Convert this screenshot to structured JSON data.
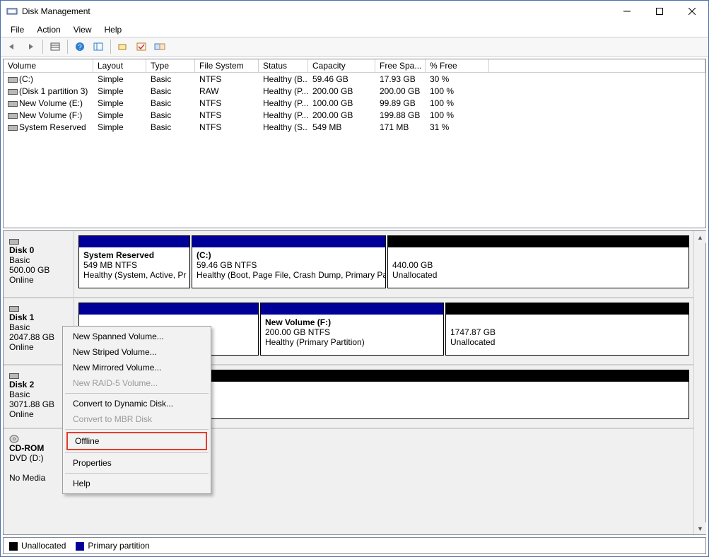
{
  "window": {
    "title": "Disk Management"
  },
  "menu": {
    "file": "File",
    "action": "Action",
    "view": "View",
    "help": "Help"
  },
  "columns": {
    "volume": "Volume",
    "layout": "Layout",
    "type": "Type",
    "fs": "File System",
    "status": "Status",
    "capacity": "Capacity",
    "free": "Free Spa...",
    "pct": "% Free"
  },
  "volumes": [
    {
      "name": "(C:)",
      "layout": "Simple",
      "type": "Basic",
      "fs": "NTFS",
      "status": "Healthy (B...",
      "capacity": "59.46 GB",
      "free": "17.93 GB",
      "pct": "30 %"
    },
    {
      "name": "(Disk 1 partition 3)",
      "layout": "Simple",
      "type": "Basic",
      "fs": "RAW",
      "status": "Healthy (P...",
      "capacity": "200.00 GB",
      "free": "200.00 GB",
      "pct": "100 %"
    },
    {
      "name": "New Volume (E:)",
      "layout": "Simple",
      "type": "Basic",
      "fs": "NTFS",
      "status": "Healthy (P...",
      "capacity": "100.00 GB",
      "free": "99.89 GB",
      "pct": "100 %"
    },
    {
      "name": "New Volume (F:)",
      "layout": "Simple",
      "type": "Basic",
      "fs": "NTFS",
      "status": "Healthy (P...",
      "capacity": "200.00 GB",
      "free": "199.88 GB",
      "pct": "100 %"
    },
    {
      "name": "System Reserved",
      "layout": "Simple",
      "type": "Basic",
      "fs": "NTFS",
      "status": "Healthy (S...",
      "capacity": "549 MB",
      "free": "171 MB",
      "pct": "31 %"
    }
  ],
  "disks": {
    "d0_name": "Disk 0",
    "d0_type": "Basic",
    "d0_size": "500.00 GB",
    "d0_status": "Online",
    "d0_p0_title": "System Reserved",
    "d0_p0_line2": "549 MB NTFS",
    "d0_p0_line3": "Healthy (System, Active, Pr",
    "d0_p1_title": "(C:)",
    "d0_p1_line2": "59.46 GB NTFS",
    "d0_p1_line3": "Healthy (Boot, Page File, Crash Dump, Primary Pa",
    "d0_p2_title": "",
    "d0_p2_line2": "440.00 GB",
    "d0_p2_line3": "Unallocated",
    "d1_name": "Disk 1",
    "d1_type": "Basic",
    "d1_size": "2047.88 GB",
    "d1_status": "Online",
    "d1_p1_title": "New Volume  (F:)",
    "d1_p1_line2": "200.00 GB NTFS",
    "d1_p1_line3": "Healthy (Primary Partition)",
    "d1_p2_line2": "1747.87 GB",
    "d1_p2_line3": "Unallocated",
    "d2_name": "Disk 2",
    "d2_type": "Basic",
    "d2_size": "3071.88 GB",
    "d2_status": "Online",
    "cd_name": "CD-ROM",
    "cd_type": "DVD (D:)",
    "cd_status": "No Media"
  },
  "legend": {
    "unallocated": "Unallocated",
    "primary": "Primary partition"
  },
  "context_menu": {
    "new_spanned": "New Spanned Volume...",
    "new_striped": "New Striped Volume...",
    "new_mirrored": "New Mirrored Volume...",
    "new_raid5": "New RAID-5 Volume...",
    "convert_dynamic": "Convert to Dynamic Disk...",
    "convert_mbr": "Convert to MBR Disk",
    "offline": "Offline",
    "properties": "Properties",
    "help": "Help"
  }
}
